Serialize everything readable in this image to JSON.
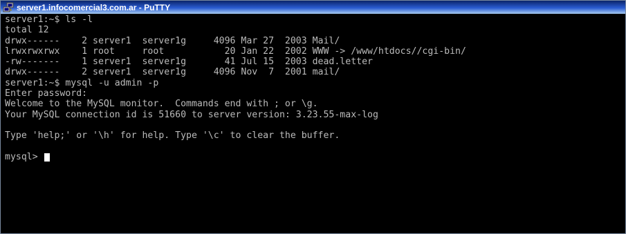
{
  "window": {
    "title": "server1.infocomercial3.com.ar - PuTTY",
    "icon": "putty-icon"
  },
  "terminal": {
    "background": "#000000",
    "foreground": "#bbbbbb",
    "lines": [
      "server1:~$ ls -l",
      "total 12",
      "drwx------    2 server1  server1g     4096 Mar 27  2003 Mail/",
      "lrwxrwxrwx    1 root     root           20 Jan 22  2002 WWW -> /www/htdocs//cgi-bin/",
      "-rw-------    1 server1  server1g       41 Jul 15  2003 dead.letter",
      "drwx------    2 server1  server1g     4096 Nov  7  2001 mail/",
      "server1:~$ mysql -u admin -p",
      "Enter password:",
      "Welcome to the MySQL monitor.  Commands end with ; or \\g.",
      "Your MySQL connection id is 51660 to server version: 3.23.55-max-log",
      "",
      "Type 'help;' or '\\h' for help. Type '\\c' to clear the buffer.",
      ""
    ],
    "prompt": "mysql> "
  }
}
